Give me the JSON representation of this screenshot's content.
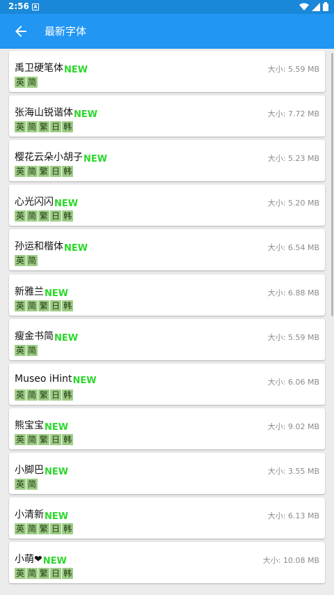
{
  "status": {
    "time": "2:56",
    "notification": "A"
  },
  "appbar": {
    "title": "最新字体"
  },
  "new_label": "NEW",
  "size_prefix": "大小: ",
  "fonts": [
    {
      "name": "禹卫硬笔体",
      "size": "5.59 MB",
      "tags": [
        "英",
        "简"
      ]
    },
    {
      "name": "张海山锐谐体",
      "size": "7.72 MB",
      "tags": [
        "英",
        "简",
        "繁",
        "日",
        "韩"
      ]
    },
    {
      "name": "樱花云朵小胡子",
      "size": "5.23 MB",
      "tags": [
        "英",
        "简",
        "繁",
        "日",
        "韩"
      ]
    },
    {
      "name": "心光闪闪",
      "size": "5.20 MB",
      "tags": [
        "英",
        "简",
        "繁",
        "日",
        "韩"
      ]
    },
    {
      "name": "孙运和楷体",
      "size": "6.54 MB",
      "tags": [
        "英",
        "简"
      ]
    },
    {
      "name": "新雅兰",
      "size": "6.88 MB",
      "tags": [
        "英",
        "简",
        "繁",
        "日",
        "韩"
      ]
    },
    {
      "name": "瘦金书简",
      "size": "5.59 MB",
      "tags": [
        "英",
        "简"
      ]
    },
    {
      "name": "Museo iHint",
      "size": "6.06 MB",
      "tags": [
        "英",
        "简",
        "繁",
        "日",
        "韩"
      ]
    },
    {
      "name": "熊宝宝",
      "size": "9.02 MB",
      "tags": [
        "英",
        "简",
        "繁",
        "日",
        "韩"
      ]
    },
    {
      "name": "小脚巴",
      "size": "3.55 MB",
      "tags": [
        "英",
        "简"
      ]
    },
    {
      "name": "小清新",
      "size": "6.13 MB",
      "tags": [
        "英",
        "简",
        "繁",
        "日",
        "韩"
      ]
    },
    {
      "name": "小萌❤",
      "size": "10.08 MB",
      "tags": [
        "英",
        "简",
        "繁",
        "日",
        "韩"
      ]
    }
  ]
}
